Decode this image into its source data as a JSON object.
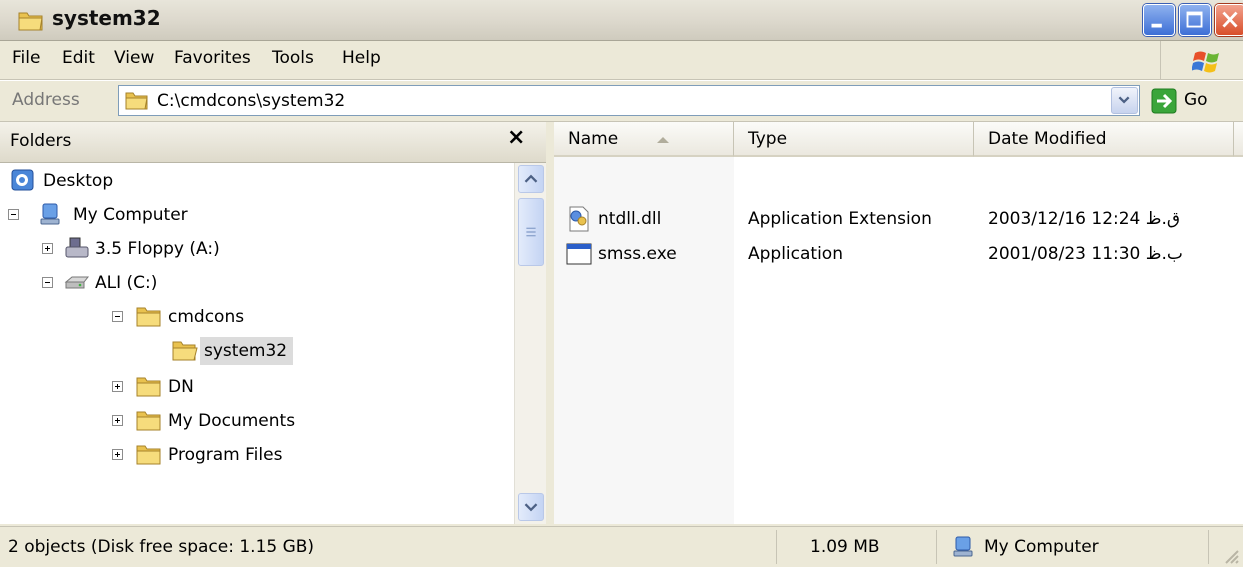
{
  "window": {
    "title": "system32"
  },
  "menu": [
    "File",
    "Edit",
    "View",
    "Favorites",
    "Tools",
    "Help"
  ],
  "address": {
    "label": "Address",
    "path": "C:\\cmdcons\\system32",
    "go_label": "Go"
  },
  "folders_pane": {
    "title": "Folders",
    "close_glyph": "×",
    "tree": [
      {
        "label": "Desktop"
      },
      {
        "label": "My Computer"
      },
      {
        "label": "3.5 Floppy (A:)"
      },
      {
        "label": "ALI (C:)"
      },
      {
        "label": "cmdcons"
      },
      {
        "label": "system32"
      },
      {
        "label": "DN"
      },
      {
        "label": "My Documents"
      },
      {
        "label": "Program Files"
      }
    ]
  },
  "file_list": {
    "columns": [
      "Name",
      "Type",
      "Date Modified"
    ],
    "rows": [
      {
        "name": "ntdll.dll",
        "type": "Application Extension",
        "date": "2003/12/16 12:24 ق.ظ"
      },
      {
        "name": "smss.exe",
        "type": "Application",
        "date": "2001/08/23 11:30 ب.ظ"
      }
    ]
  },
  "status": {
    "objects": "2 objects (Disk free space: 1.15 GB)",
    "size": "1.09 MB",
    "zone": "My Computer"
  }
}
